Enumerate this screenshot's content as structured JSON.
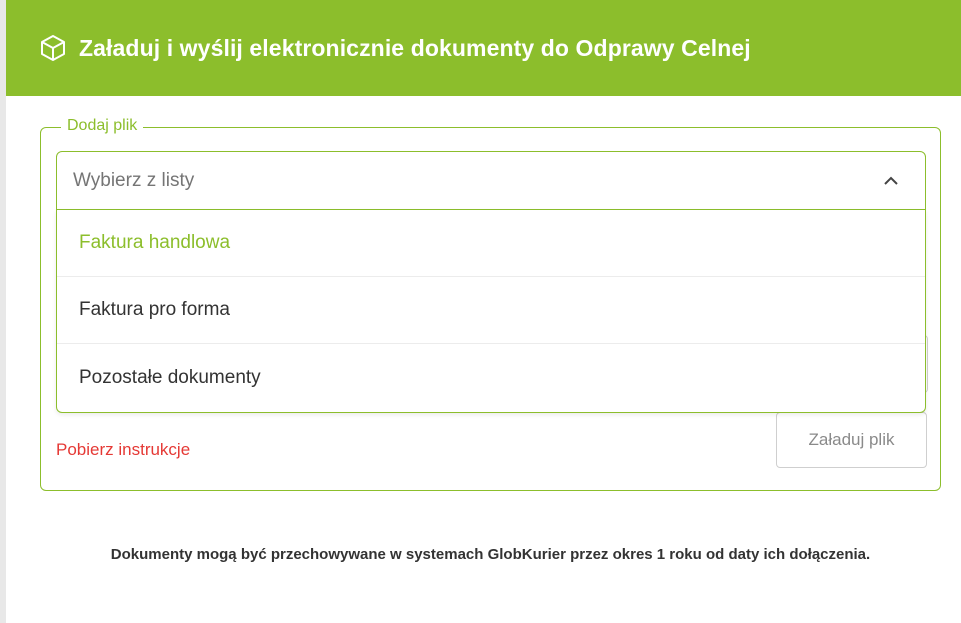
{
  "header": {
    "icon": "box-icon",
    "title": "Załaduj i wyślij elektronicznie dokumenty do Odprawy Celnej",
    "bg_color": "#8cbe2c"
  },
  "form": {
    "legend": "Dodaj plik",
    "select": {
      "placeholder": "Wybierz z listy",
      "expanded": true,
      "icon": "chevron-up-icon"
    },
    "options": [
      {
        "label": "Faktura handlowa",
        "highlighted": true
      },
      {
        "label": "Faktura pro forma",
        "highlighted": false
      },
      {
        "label": "Pozostałe dokumenty",
        "highlighted": false
      }
    ],
    "download_link": "Pobierz instrukcje",
    "upload_button": "Załaduj plik"
  },
  "note": "Dokumenty mogą być przechowywane w systemach GlobKurier przez okres 1 roku od daty ich dołączenia.",
  "colors": {
    "accent": "#8cbe2c",
    "link": "#e53935"
  }
}
